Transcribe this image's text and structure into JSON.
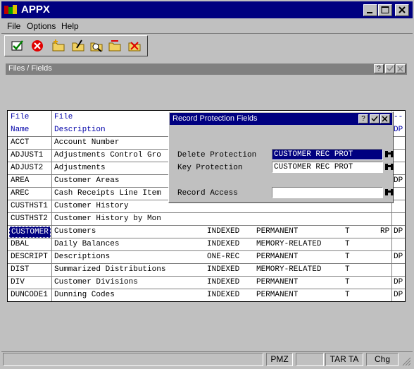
{
  "app": {
    "title": "APPX"
  },
  "menu": [
    {
      "label": "File"
    },
    {
      "label": "Options"
    },
    {
      "label": "Help"
    }
  ],
  "window": {
    "title": "Files / Fields",
    "help_btn": "?"
  },
  "dialog": {
    "title": "Record Protection Fields",
    "help_btn": "?",
    "fields": [
      {
        "label": "Delete Protection",
        "value": "CUSTOMER REC PROT",
        "selected": true
      },
      {
        "label": "Key Protection",
        "value": "CUSTOMER REC PROT",
        "selected": false
      },
      {
        "label": "Record Access",
        "value": "",
        "selected": false
      }
    ]
  },
  "table": {
    "headers": {
      "name_1": "File",
      "name_2": "Name",
      "desc_1": "File",
      "desc_2": "Description",
      "last_1": "--",
      "last_2": "DP"
    },
    "rows": [
      {
        "name": "ACCT",
        "desc": "Account Number",
        "org": "",
        "type": "",
        "t": "",
        "rp": "",
        "dp": ""
      },
      {
        "name": "ADJUST1",
        "desc": "Adjustments Control Gro",
        "org": "",
        "type": "",
        "t": "",
        "rp": "",
        "dp": ""
      },
      {
        "name": "ADJUST2",
        "desc": "Adjustments",
        "org": "",
        "type": "",
        "t": "",
        "rp": "",
        "dp": ""
      },
      {
        "name": "AREA",
        "desc": "Customer Areas",
        "org": "",
        "type": "",
        "t": "",
        "rp": "",
        "dp": "DP"
      },
      {
        "name": "AREC",
        "desc": "Cash Receipts Line Item",
        "org": "",
        "type": "",
        "t": "",
        "rp": "",
        "dp": ""
      },
      {
        "name": "CUSTHST1",
        "desc": "Customer History",
        "org": "",
        "type": "",
        "t": "",
        "rp": "",
        "dp": ""
      },
      {
        "name": "CUSTHST2",
        "desc": "Customer History by Mon",
        "org": "",
        "type": "",
        "t": "",
        "rp": "",
        "dp": ""
      },
      {
        "name": "CUSTOMER",
        "desc": "Customers",
        "org": "INDEXED",
        "type": "PERMANENT",
        "t": "T",
        "rp": "RP",
        "dp": "DP"
      },
      {
        "name": "DBAL",
        "desc": "Daily Balances",
        "org": "INDEXED",
        "type": "MEMORY-RELATED",
        "t": "T",
        "rp": "",
        "dp": ""
      },
      {
        "name": "DESCRIPT",
        "desc": "Descriptions",
        "org": "ONE-REC",
        "type": "PERMANENT",
        "t": "T",
        "rp": "",
        "dp": "DP"
      },
      {
        "name": "DIST",
        "desc": "Summarized Distributions",
        "org": "INDEXED",
        "type": "MEMORY-RELATED",
        "t": "T",
        "rp": "",
        "dp": ""
      },
      {
        "name": "DIV",
        "desc": "Customer Divisions",
        "org": "INDEXED",
        "type": "PERMANENT",
        "t": "T",
        "rp": "",
        "dp": "DP"
      },
      {
        "name": "DUNCODE1",
        "desc": "Dunning Codes",
        "org": "INDEXED",
        "type": "PERMANENT",
        "t": "T",
        "rp": "",
        "dp": "DP"
      }
    ]
  },
  "status": {
    "pmz": "PMZ",
    "tar": "TAR TA",
    "chg": "Chg"
  },
  "colors": {
    "title_bar": "#000080",
    "selection": "#000080",
    "header_text": "#0000a8",
    "face": "#c0c0c0"
  }
}
